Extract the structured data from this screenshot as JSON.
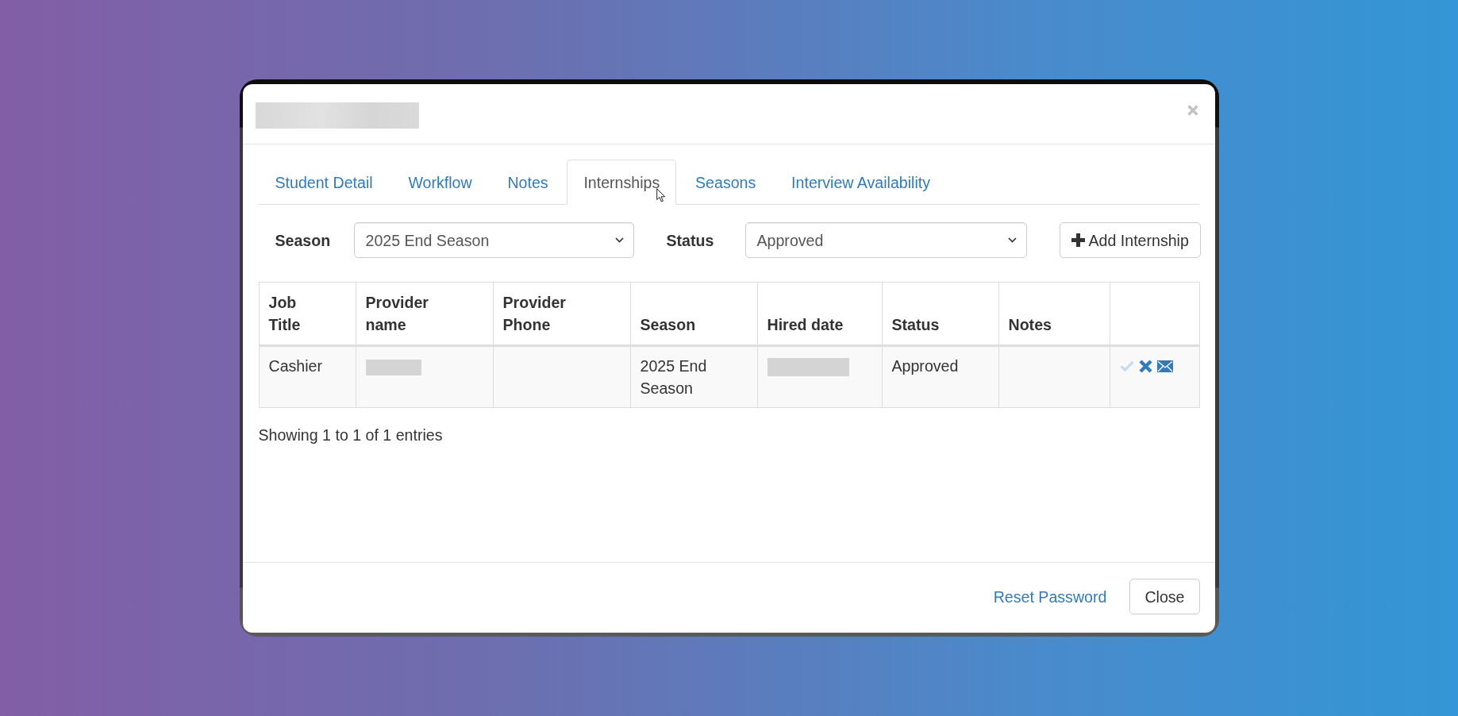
{
  "dialog_title": {
    "kind": "redacted"
  },
  "tabs": [
    {
      "label": "Student Detail",
      "selected": false
    },
    {
      "label": "Workflow",
      "selected": false
    },
    {
      "label": "Notes",
      "selected": false
    },
    {
      "label": "Internships",
      "selected": true
    },
    {
      "label": "Seasons",
      "selected": false
    },
    {
      "label": "Interview Availability",
      "selected": false
    }
  ],
  "filters": [
    {
      "label": "Season",
      "value": "2025 End Season"
    },
    {
      "label": "Status",
      "value": "Approved"
    }
  ],
  "add_button": {
    "label": "Add Internship"
  },
  "table": {
    "columns": [
      "Job Title",
      "Provider name",
      "Provider Phone",
      "Season",
      "Hired date",
      "Status",
      "Notes"
    ],
    "rows": [
      {
        "cells": [
          {
            "kind": "text",
            "text": "Cashier"
          },
          {
            "kind": "redacted"
          },
          {
            "kind": "blank"
          },
          {
            "kind": "text",
            "text": "2025 End Season"
          },
          {
            "kind": "redacted"
          },
          {
            "kind": "text",
            "text": "Approved"
          },
          {
            "kind": "blank"
          },
          {
            "kind": "actions",
            "actions": [
              {
                "kind": "approve",
                "disabled": true
              },
              {
                "kind": "reject",
                "disabled": false
              },
              {
                "kind": "email",
                "disabled": false
              }
            ]
          }
        ]
      }
    ]
  },
  "table_info": "Showing 1 to 1 of 1 entries",
  "footer": {
    "link": "Reset Password",
    "button": "Close"
  }
}
